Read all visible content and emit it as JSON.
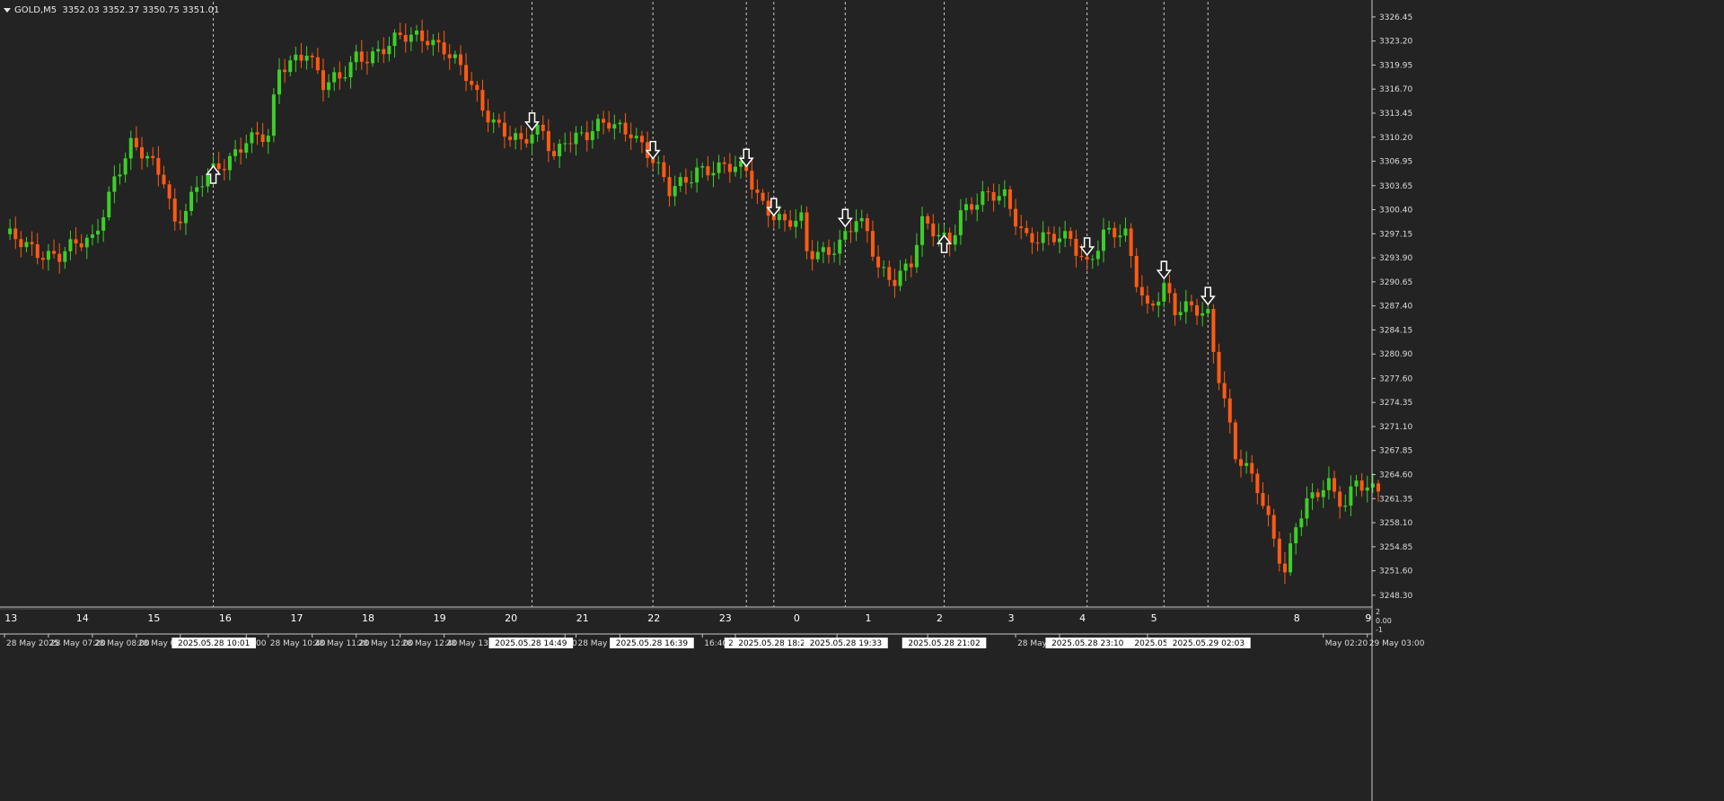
{
  "header": {
    "symbol": "GOLD,M5",
    "ohlc": "3352.03 3352.37 3350.75 3351.01"
  },
  "colors": {
    "background": "#232323",
    "bull": "#3ccf28",
    "bear": "#ff5a14",
    "axis": "#c8c8c8",
    "text": "#dcdcdc",
    "vline": "#e6e6e6"
  },
  "price_axis": {
    "labels": [
      "3326.45",
      "3323.20",
      "3319.95",
      "3316.70",
      "3313.45",
      "3310.20",
      "3306.95",
      "3303.65",
      "3300.40",
      "3297.15",
      "3293.90",
      "3290.65",
      "3287.40",
      "3284.15",
      "3280.90",
      "3277.60",
      "3274.35",
      "3271.10",
      "3267.85",
      "3264.60",
      "3261.35",
      "3258.10",
      "3254.85",
      "3251.60",
      "3248.30"
    ]
  },
  "indicator_axis": {
    "labels": [
      "2",
      "0.00",
      "-1"
    ]
  },
  "indicator_row": {
    "labels": [
      "13",
      "14",
      "15",
      "16",
      "17",
      "18",
      "19",
      "20",
      "21",
      "22",
      "23",
      "0",
      "1",
      "2",
      "3",
      "4",
      "5",
      "8",
      "9"
    ],
    "x": [
      0.2,
      13.2,
      26.2,
      39.2,
      52.2,
      65.2,
      78.2,
      91.2,
      104.2,
      117.2,
      130.2,
      143.2,
      156.2,
      169.2,
      182.2,
      195.2,
      208.2,
      234.2,
      247.2
    ]
  },
  "time_axis": {
    "labels": [
      {
        "text": "28 May 2025",
        "x": 0
      },
      {
        "text": "28 May 07:20",
        "x": 8
      },
      {
        "text": "28 May 08:00",
        "x": 16
      },
      {
        "text": "28 May 08:40",
        "x": 24
      },
      {
        "text": "28 Ma",
        "x": 32
      },
      {
        "text": "0:00",
        "x": 44
      },
      {
        "text": "28 May 10:40",
        "x": 48
      },
      {
        "text": "28 May 11:20",
        "x": 56
      },
      {
        "text": "28 May 12:00",
        "x": 64
      },
      {
        "text": "28 May 12:40",
        "x": 72
      },
      {
        "text": "28 May 13:20",
        "x": 80
      },
      {
        "text": "40",
        "x": 102
      },
      {
        "text": "28 May 15:20",
        "x": 104
      },
      {
        "text": "28 I",
        "x": 112
      },
      {
        "text": "16:40",
        "x": 127
      },
      {
        "text": "28 Ma",
        "x": 133
      },
      {
        "text": "May 1",
        "x": 151.5
      },
      {
        "text": "28 May 20:00",
        "x": 168
      },
      {
        "text": "28 May 21:20",
        "x": 184
      },
      {
        "text": "28 May 22:00",
        "x": 192
      },
      {
        "text": "28 May 23:20",
        "x": 208
      },
      {
        "text": "May 02:20",
        "x": 240
      },
      {
        "text": "29 May 03:00",
        "x": 248
      }
    ],
    "markers": [
      {
        "text": "2025.05.28 10:01",
        "x": 38.1
      },
      {
        "text": "2025.05.28 14:49",
        "x": 95.8
      },
      {
        "text": "2025.05.28 16:39",
        "x": 117.8
      },
      {
        "text": "2025.05.",
        "x": 135
      },
      {
        "text": "2025.05.28 18:28",
        "x": 140.1
      },
      {
        "text": "2025.05.28 19:33",
        "x": 153.1
      },
      {
        "text": "2025.05.28 21:02",
        "x": 171
      },
      {
        "text": "2025.05.28 23:10",
        "x": 197.1
      },
      {
        "text": "2025.05.29 01",
        "x": 211
      },
      {
        "text": "2025.05.29 02:03",
        "x": 219.1
      }
    ]
  },
  "chart_data": {
    "type": "candlestick",
    "x_unit": "bar index (5-minute bars)",
    "ylim": [
      3246.7,
      3328.5
    ],
    "y_ticks": [
      3326.45,
      3323.2,
      3319.95,
      3316.7,
      3313.45,
      3310.2,
      3306.95,
      3303.65,
      3300.4,
      3297.15,
      3293.9,
      3290.65,
      3287.4,
      3284.15,
      3280.9,
      3277.6,
      3274.35,
      3271.1,
      3267.85,
      3264.6,
      3261.35,
      3258.1,
      3254.85,
      3251.6,
      3248.3
    ],
    "key_points": [
      [
        0,
        3296.5
      ],
      [
        10,
        3294.2
      ],
      [
        16,
        3296.3
      ],
      [
        20,
        3305.0
      ],
      [
        23,
        3308.8
      ],
      [
        29,
        3305.0
      ],
      [
        31,
        3298.9
      ],
      [
        36,
        3303.8
      ],
      [
        40,
        3306.7
      ],
      [
        44,
        3310.4
      ],
      [
        48,
        3309.8
      ],
      [
        50,
        3319.0
      ],
      [
        55,
        3322.5
      ],
      [
        58,
        3317.2
      ],
      [
        61,
        3317.5
      ],
      [
        64,
        3321.2
      ],
      [
        68,
        3322.0
      ],
      [
        72,
        3323.2
      ],
      [
        77,
        3324.0
      ],
      [
        80,
        3322.5
      ],
      [
        84,
        3318.0
      ],
      [
        87,
        3314.0
      ],
      [
        91,
        3311.5
      ],
      [
        94,
        3309.2
      ],
      [
        98,
        3310.8
      ],
      [
        100,
        3307.7
      ],
      [
        102,
        3310.6
      ],
      [
        106,
        3310.2
      ],
      [
        110,
        3312.0
      ],
      [
        114,
        3311.5
      ],
      [
        117,
        3308.0
      ],
      [
        121,
        3302.6
      ],
      [
        126,
        3306.3
      ],
      [
        130,
        3305.5
      ],
      [
        135,
        3306.0
      ],
      [
        138,
        3301.5
      ],
      [
        142,
        3298.0
      ],
      [
        145,
        3298.7
      ],
      [
        146,
        3294.7
      ],
      [
        148,
        3295.0
      ],
      [
        152,
        3295.8
      ],
      [
        155,
        3298.5
      ],
      [
        157,
        3297.0
      ],
      [
        159,
        3292.8
      ],
      [
        162,
        3291.5
      ],
      [
        165,
        3293.0
      ],
      [
        167,
        3298.0
      ],
      [
        170,
        3297.0
      ],
      [
        172,
        3296.5
      ],
      [
        174,
        3300.5
      ],
      [
        178,
        3301.5
      ],
      [
        182,
        3302.3
      ],
      [
        186,
        3297.0
      ],
      [
        190,
        3296.0
      ],
      [
        194,
        3296.5
      ],
      [
        197,
        3293.5
      ],
      [
        200,
        3297.0
      ],
      [
        204,
        3296.5
      ],
      [
        206,
        3291.0
      ],
      [
        208,
        3287.5
      ],
      [
        211,
        3290.2
      ],
      [
        213,
        3286.3
      ],
      [
        217,
        3286.8
      ],
      [
        219,
        3286.6
      ],
      [
        220,
        3282.0
      ],
      [
        222,
        3275.0
      ],
      [
        224,
        3267.0
      ],
      [
        228,
        3262.5
      ],
      [
        231,
        3256.5
      ],
      [
        233,
        3251.8
      ],
      [
        235,
        3258.0
      ],
      [
        237,
        3260.2
      ],
      [
        241,
        3263.2
      ],
      [
        244,
        3261.0
      ],
      [
        246,
        3264.5
      ],
      [
        248,
        3262.0
      ],
      [
        250,
        3262.3
      ]
    ],
    "signals": [
      {
        "dir": "up",
        "x": 38
      },
      {
        "dir": "down",
        "x": 96
      },
      {
        "dir": "down",
        "x": 118
      },
      {
        "dir": "down",
        "x": 135
      },
      {
        "dir": "down",
        "x": 140
      },
      {
        "dir": "down",
        "x": 153
      },
      {
        "dir": "up",
        "x": 171
      },
      {
        "dir": "down",
        "x": 197
      },
      {
        "dir": "down",
        "x": 211
      },
      {
        "dir": "down",
        "x": 219
      }
    ]
  }
}
